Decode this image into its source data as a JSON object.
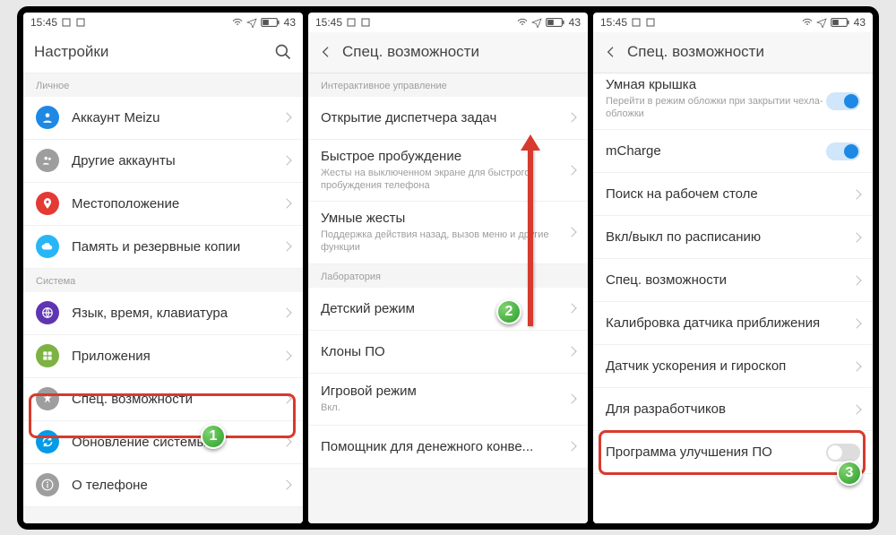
{
  "status": {
    "time": "15:45",
    "battery": "43"
  },
  "screen1": {
    "title": "Настройки",
    "sections": {
      "personal_label": "Личное",
      "system_label": "Система"
    },
    "rows": {
      "meizu": "Аккаунт Meizu",
      "other": "Другие аккаунты",
      "location": "Местоположение",
      "backup": "Память и резервные копии",
      "lang": "Язык, время, клавиатура",
      "apps": "Приложения",
      "accessibility": "Спец. возможности",
      "update": "Обновление системы",
      "about": "О телефоне"
    }
  },
  "screen2": {
    "title": "Спец. возможности",
    "section_interactive": "Интерактивное управление",
    "section_lab": "Лаборатория",
    "rows": {
      "task_manager": "Открытие диспетчера задач",
      "fast_wake": "Быстрое пробуждение",
      "fast_wake_sub": "Жесты на выключенном экране для быстрого пробуждения телефона",
      "smart_gestures": "Умные жесты",
      "smart_gestures_sub": "Поддержка действия назад, вызов меню и другие функции",
      "kids": "Детский режим",
      "clones": "Клоны ПО",
      "game": "Игровой режим",
      "game_sub": "Вкл.",
      "money": "Помощник для денежного конве..."
    }
  },
  "screen3": {
    "title": "Спец. возможности",
    "rows": {
      "cover": "Умная крышка",
      "cover_sub": "Перейти в режим обложки при закрытии чехла-обложки",
      "mcharge": "mCharge",
      "search": "Поиск на рабочем столе",
      "schedule": "Вкл/выкл по расписанию",
      "access": "Спец. возможности",
      "proximity": "Калибровка датчика приближения",
      "accel": "Датчик ускорения и гироскоп",
      "dev": "Для разработчиков",
      "improve": "Программа улучшения ПО"
    }
  },
  "badges": {
    "b1": "1",
    "b2": "2",
    "b3": "3"
  }
}
